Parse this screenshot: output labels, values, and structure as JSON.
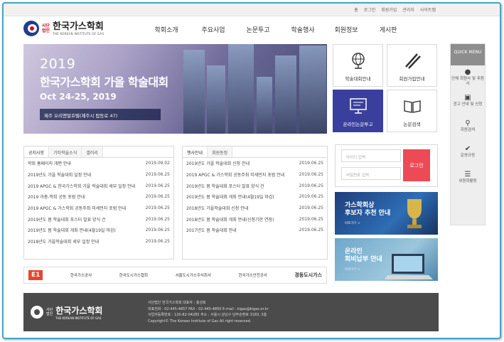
{
  "topbar": {
    "links": [
      "홈",
      "로그인",
      "회원가입",
      "관리자",
      "사이트맵"
    ]
  },
  "logo": {
    "corp": "사단\n법인",
    "name": "한국가스학회",
    "eng": "THE KOREAN INSTITUTE OF GAS"
  },
  "nav": [
    "학회소개",
    "주요사업",
    "논문투고",
    "학술행사",
    "회원정보",
    "게시판"
  ],
  "quick": {
    "title": "QUICK MENU",
    "items": [
      {
        "icon": "person-icon",
        "label": "단체 회원사 및 후원사"
      },
      {
        "icon": "billboard-icon",
        "label": "광고 안내 및 신청"
      },
      {
        "icon": "search-icon",
        "label": "회원검색"
      },
      {
        "icon": "check-icon",
        "label": "운영규정"
      },
      {
        "icon": "list-icon",
        "label": "위원회활동"
      }
    ]
  },
  "banner": {
    "year": "2019",
    "title": "한국가스학회 가을 학술대회",
    "date": "Oct 24-25, 2019",
    "place": "제주 오리엔탈호텔(제주시 탑동로 47)"
  },
  "tiles": [
    {
      "name": "conference-guide",
      "label": "학술대회안내",
      "icon": "globe-icon"
    },
    {
      "name": "membership-guide",
      "label": "회원가입안내",
      "icon": "pens-icon"
    },
    {
      "name": "online-submission",
      "label": "온라인논문투고",
      "icon": "monitor-icon"
    },
    {
      "name": "paper-search",
      "label": "논문검색",
      "icon": "book-icon"
    }
  ],
  "board_left": {
    "tabs": [
      "공지사항",
      "기타학술소식",
      "갤러리"
    ],
    "rows": [
      {
        "title": "학회 홈페이지 개편 안내",
        "date": "2019.09.02"
      },
      {
        "title": "2019년도 가을 학술대회 일정 안내",
        "date": "2019.06.25"
      },
      {
        "title": "2019 APGC & 한국가스학회 가을 학술대회 세부 일정 안내",
        "date": "2019.06.25"
      },
      {
        "title": "2019 과총-학회 공동 포럼 안내",
        "date": "2019.06.25"
      },
      {
        "title": "2019 APGC & 가스학회 공동주최 미세먼지 포럼 안내",
        "date": "2019.06.25"
      },
      {
        "title": "2019년도 봄 학술대회 포스터 발표 양식 건",
        "date": "2019.06.25"
      },
      {
        "title": "2019년도 봄 학술대회 개최 안내(4월19일 마감)",
        "date": "2019.06.25"
      },
      {
        "title": "2018년도 가을학술대회 세부 일정 안내",
        "date": "2019.06.25"
      }
    ]
  },
  "board_right": {
    "tabs": [
      "행사안내",
      "회원동정"
    ],
    "rows": [
      {
        "title": "2019년도 가을 학술대회 신청 안내",
        "date": "2019.06.25"
      },
      {
        "title": "2019 APGC & 가스학회 공동주최 미세먼지 포럼 안내",
        "date": "2019.06.25"
      },
      {
        "title": "2019년도 봄 학술대회 포스터 발표 양식 건",
        "date": "2019.06.25"
      },
      {
        "title": "2019년도 봄 학술대회 개최 안내(4월19일 마감)",
        "date": "2019.06.25"
      },
      {
        "title": "2018년도 가을학술대회 신청 안내",
        "date": "2019.06.25"
      },
      {
        "title": "2018년도 봄 학술대회 개최 안내(신청기한 연장)",
        "date": "2019.06.25"
      },
      {
        "title": "2017년도 봄 학술대회 안내",
        "date": "2019.06.25"
      }
    ]
  },
  "login": {
    "id_placeholder": "아이디 입력",
    "pw_placeholder": "비밀번호 입력",
    "button": "로그인"
  },
  "ads": [
    {
      "title": "가스학회상\n후보자 추천 안내",
      "more": "바로가기 >"
    },
    {
      "title": "온라인\n회비납부 안내",
      "more": "바로가기 >"
    }
  ],
  "partners": [
    "E1",
    "한국가스공사",
    "한국도시가스협회",
    "서울도시가스주식회사",
    "한국가스안전공사",
    "경동도시가스"
  ],
  "footer": {
    "lines": [
      "사단법인 한국가스학회 대표자 : 홍성호",
      "대표전화 : 02-445-4857 FAX : 02-445-4850 E-mail : kigas@kigas.or.kr",
      "사업자등록번호 : 120-82-04285 주소 : 서울시 강남구 남부순환로 3183, 3층",
      "Copyright© The Korean Institute of Gas All right reserved."
    ]
  }
}
